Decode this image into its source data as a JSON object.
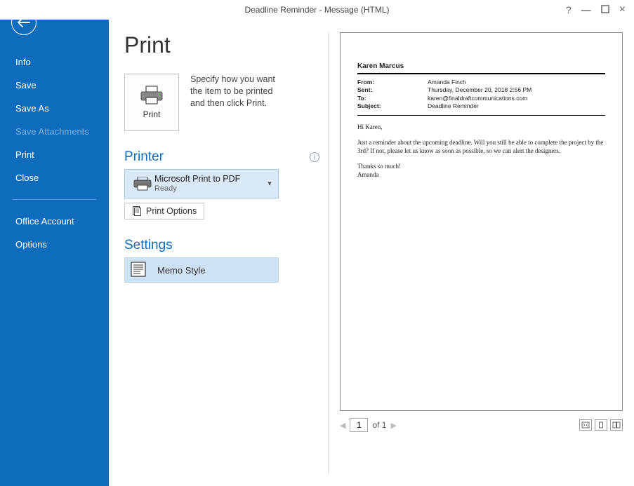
{
  "window": {
    "title": "Deadline Reminder - Message (HTML)"
  },
  "sidebar": {
    "items": [
      {
        "label": "Info",
        "disabled": false
      },
      {
        "label": "Save",
        "disabled": false
      },
      {
        "label": "Save As",
        "disabled": false
      },
      {
        "label": "Save Attachments",
        "disabled": true
      },
      {
        "label": "Print",
        "disabled": false
      },
      {
        "label": "Close",
        "disabled": false
      }
    ],
    "footer_items": [
      {
        "label": "Office Account"
      },
      {
        "label": "Options"
      }
    ]
  },
  "main": {
    "heading": "Print",
    "tile_label": "Print",
    "tile_desc": "Specify how you want the item to be printed and then click Print.",
    "printer_section": "Printer",
    "printer_name": "Microsoft Print to PDF",
    "printer_status": "Ready",
    "print_options_label": "Print Options",
    "settings_section": "Settings",
    "style_label": "Memo Style"
  },
  "preview": {
    "from_name": "Karen Marcus",
    "headers": {
      "from_label": "From:",
      "from_value": "Amanda Finch",
      "sent_label": "Sent:",
      "sent_value": "Thursday, December 20, 2018 2:56 PM",
      "to_label": "To:",
      "to_value": "karen@finaldraftcommunications.com",
      "subject_label": "Subject:",
      "subject_value": "Deadline Reminder"
    },
    "body": {
      "greeting": "Hi Karen,",
      "para1": "Just a reminder about the upcoming deadline. Will you still be able to complete the project by the 3rd? If not, please let us know as soon as possible, so we can alert the designers.",
      "closing1": "Thanks so much!",
      "closing2": "Amanda"
    },
    "pager": {
      "current": "1",
      "total_label": "of 1"
    }
  }
}
